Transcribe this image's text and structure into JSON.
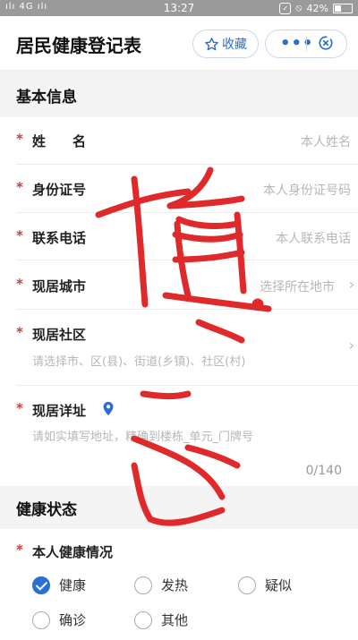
{
  "status": {
    "signal": "ılı 4G ılı",
    "time": "13:27",
    "battery": "42%"
  },
  "header": {
    "title": "居民健康登记表",
    "fav_label": "收藏",
    "more_label": "•••"
  },
  "section_basic": {
    "title": "基本信息",
    "fields": [
      {
        "label": "姓　　名",
        "placeholder": "本人姓名"
      },
      {
        "label": "身份证号",
        "placeholder": "本人身份证号码"
      },
      {
        "label": "联系电话",
        "placeholder": "本人联系电话"
      },
      {
        "label": "现居城市",
        "placeholder": "选择所在地市"
      },
      {
        "label": "现居社区",
        "placeholder": "请选择市、区(县)、街道(乡镇)、社区(村)"
      },
      {
        "label": "现居详址",
        "placeholder": "请如实填写地址，精确到楼栋_单元_门牌号",
        "counter": "0/140"
      }
    ]
  },
  "section_health": {
    "title": "健康状态",
    "question": "本人健康情况",
    "options": [
      {
        "label": "健康",
        "checked": true
      },
      {
        "label": "发热",
        "checked": false
      },
      {
        "label": "疑似",
        "checked": false
      },
      {
        "label": "确诊",
        "checked": false
      },
      {
        "label": "其他",
        "checked": false
      }
    ]
  },
  "colors": {
    "accent": "#2b6fd6",
    "required": "#d63b3b",
    "ink": "#e0292b"
  }
}
